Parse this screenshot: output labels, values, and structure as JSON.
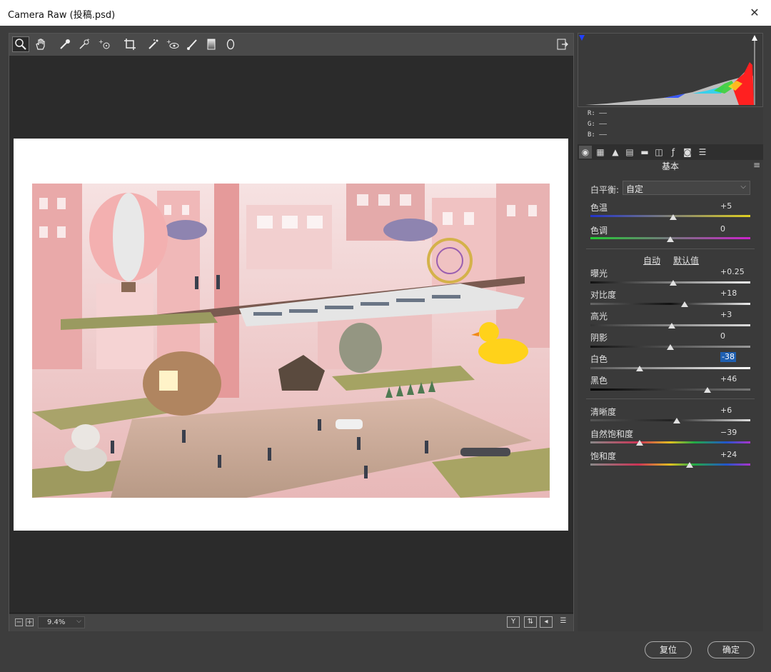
{
  "window": {
    "title": "Camera Raw (投稿.psd)",
    "close": "✕"
  },
  "toolbar": {
    "tools": [
      "zoom-icon",
      "hand-icon",
      "white-balance-icon",
      "color-sampler-icon",
      "target-adjust-icon",
      "crop-icon",
      "spot-removal-icon",
      "red-eye-icon",
      "adjustment-brush-icon",
      "graduated-filter-icon",
      "radial-filter-icon"
    ],
    "export_icon": "open-preferences-icon"
  },
  "status": {
    "zoom_out": "−",
    "zoom_in": "+",
    "zoom_value": "9.4%",
    "zoom_chevron": "⌵",
    "view_buttons": [
      "Y",
      "⇅",
      "◂",
      "☰"
    ]
  },
  "readout": {
    "r": "R:  ——",
    "g": "G:  ——",
    "b": "B:  ——"
  },
  "panel": {
    "section_title": "基本",
    "menu": "≡",
    "white_balance_label": "白平衡:",
    "white_balance_value": "自定",
    "auto": "自动",
    "default": "默认值",
    "sliders": {
      "temp": {
        "label": "色温",
        "value": "+5",
        "pos": 0.52
      },
      "tint": {
        "label": "色调",
        "value": "0",
        "pos": 0.5
      },
      "exposure": {
        "label": "曝光",
        "value": "+0.25",
        "pos": 0.52
      },
      "contrast": {
        "label": "对比度",
        "value": "+18",
        "pos": 0.59
      },
      "highlights": {
        "label": "高光",
        "value": "+3",
        "pos": 0.51
      },
      "shadows": {
        "label": "阴影",
        "value": "0",
        "pos": 0.5
      },
      "whites": {
        "label": "白色",
        "value": "-38",
        "pos": 0.31
      },
      "blacks": {
        "label": "黑色",
        "value": "+46",
        "pos": 0.73
      },
      "clarity": {
        "label": "清晰度",
        "value": "+6",
        "pos": 0.54
      },
      "vibrance": {
        "label": "自然饱和度",
        "value": "−39",
        "pos": 0.31
      },
      "saturation": {
        "label": "饱和度",
        "value": "+24",
        "pos": 0.62
      }
    }
  },
  "buttons": {
    "reset": "复位",
    "ok": "确定"
  },
  "colors": {
    "accent": "#1f5fb0",
    "panel": "#3a3a3a",
    "canvas": "#2b2b2b"
  }
}
